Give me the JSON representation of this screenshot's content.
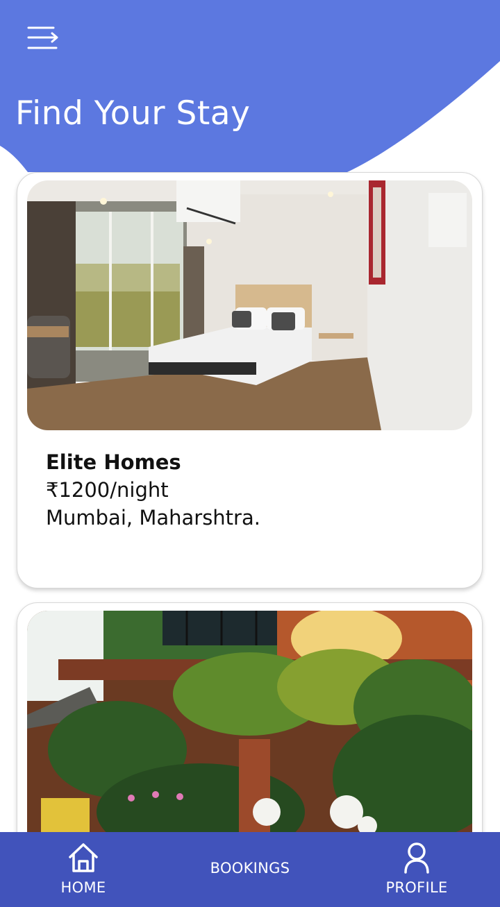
{
  "header": {
    "title": "Find Your Stay",
    "menu_icon": "menu-icon",
    "background_color": "#5c78e0"
  },
  "listings": [
    {
      "name": "Elite Homes",
      "price": "₹1200/night",
      "location": "Mumbai, Maharshtra.",
      "image": "hotel-room-photo"
    },
    {
      "name": "",
      "price": "",
      "location": "",
      "image": "garden-building-photo"
    }
  ],
  "bottom_nav": {
    "background_color": "#4153bb",
    "items": [
      {
        "label": "HOME",
        "icon": "home-icon"
      },
      {
        "label": "BOOKINGS",
        "icon": ""
      },
      {
        "label": "PROFILE",
        "icon": "user-icon"
      }
    ]
  }
}
